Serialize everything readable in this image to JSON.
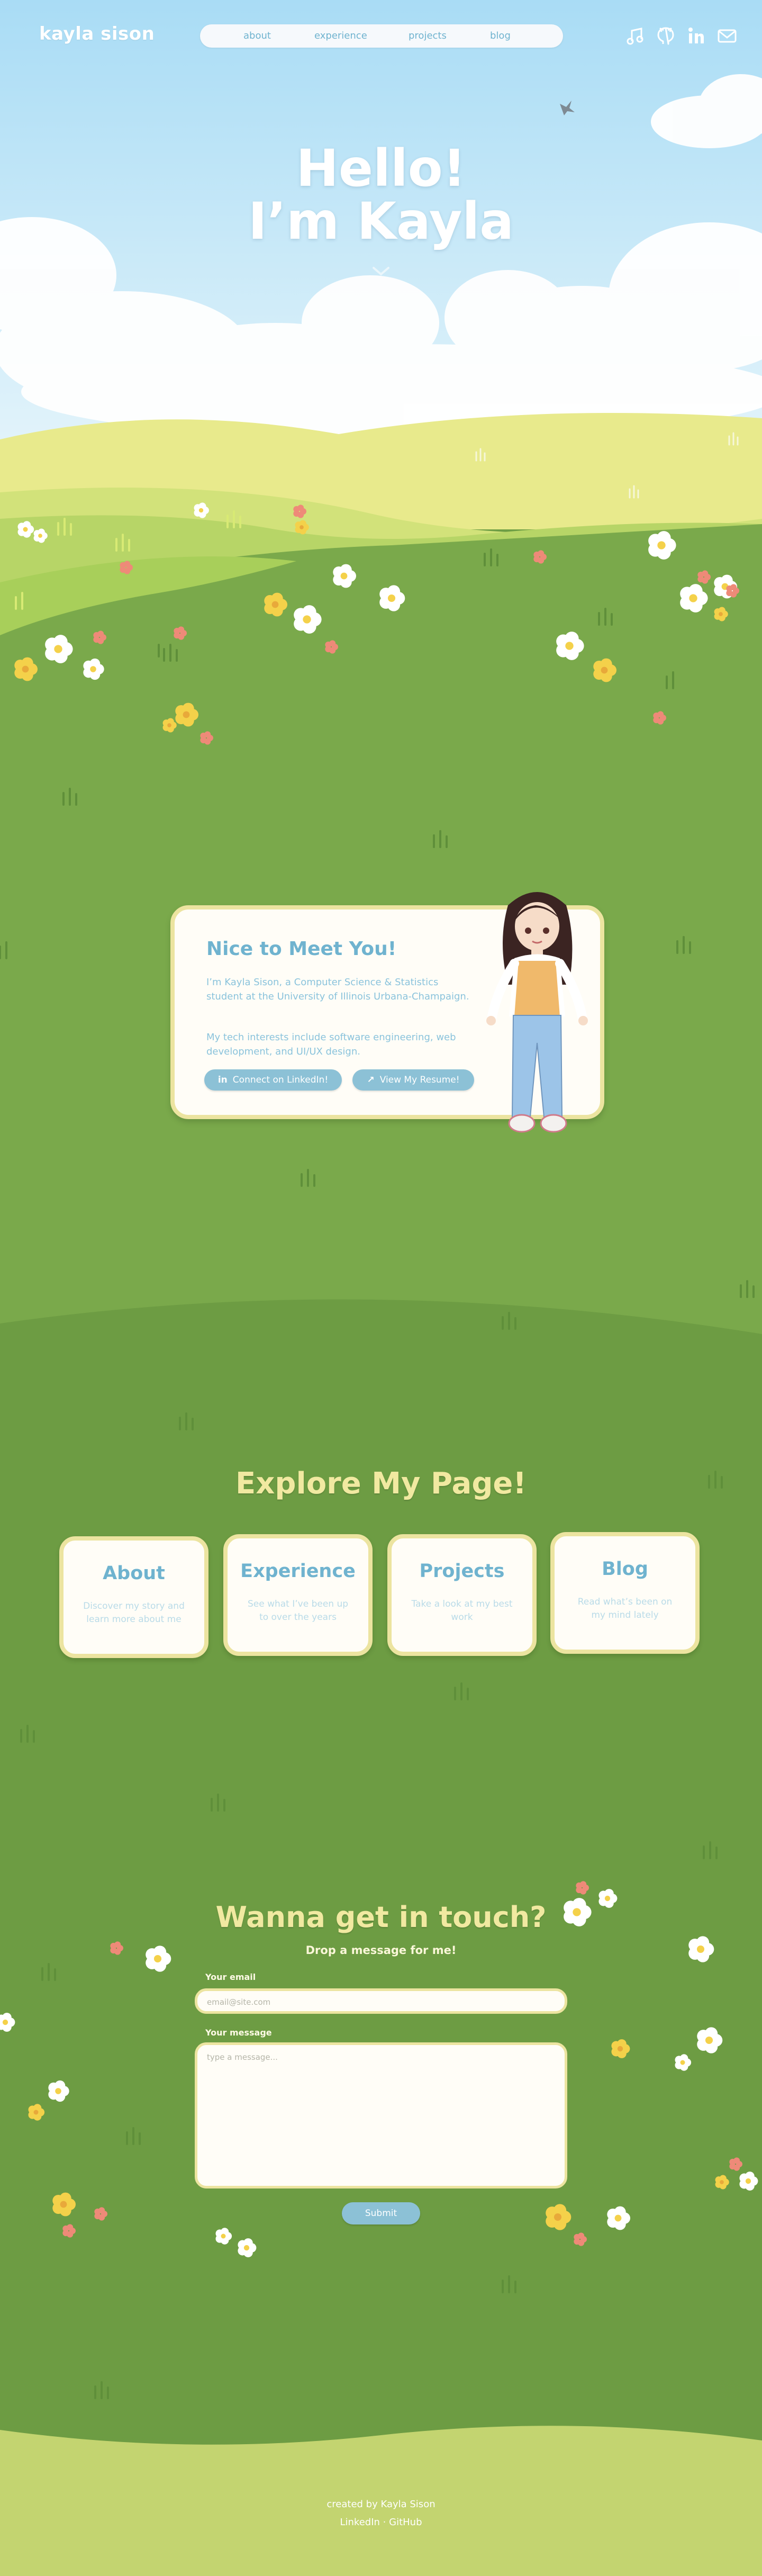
{
  "nav": {
    "brand": "kayla sison",
    "links": [
      "about",
      "experience",
      "projects",
      "blog"
    ],
    "social_icons": [
      "music-icon",
      "github-icon",
      "linkedin-icon",
      "mail-icon"
    ]
  },
  "hero": {
    "line1": "Hello!",
    "line2": "I’m Kayla",
    "scroll_icon": "chevron-down-icon"
  },
  "about": {
    "title": "Nice to Meet You!",
    "para1": "I’m Kayla Sison, a Computer Science & Statistics student at the University of Illinois Urbana-Champaign.",
    "para2": "My tech interests include software engineering, web development, and UI/UX design.",
    "linkedin_button": "Connect on LinkedIn!",
    "resume_button": "View My Resume!"
  },
  "explore": {
    "title": "Explore My Page!",
    "tiles": [
      {
        "title": "About",
        "desc": "Discover my story and learn more about me"
      },
      {
        "title": "Experience",
        "desc": "See what I’ve been up to over the years"
      },
      {
        "title": "Projects",
        "desc": "Take a look at my best work"
      },
      {
        "title": "Blog",
        "desc": "Read what’s been on my mind lately"
      }
    ]
  },
  "contact": {
    "title": "Wanna get in touch?",
    "subtitle": "Drop a message for me!",
    "email_label": "Your email",
    "email_placeholder": "email@site.com",
    "message_label": "Your message",
    "message_placeholder": "type a message...",
    "submit": "Submit"
  },
  "footer": {
    "credit": "created by Kayla Sison",
    "links": [
      "LinkedIn",
      "GitHub"
    ],
    "separator": "·"
  },
  "colors": {
    "sky_top": "#b9e3f7",
    "grass": "#6e9e45",
    "accent_blue": "#6fb3cf",
    "card_border": "#ece4a0",
    "title_yellow": "#f1e9a1"
  }
}
